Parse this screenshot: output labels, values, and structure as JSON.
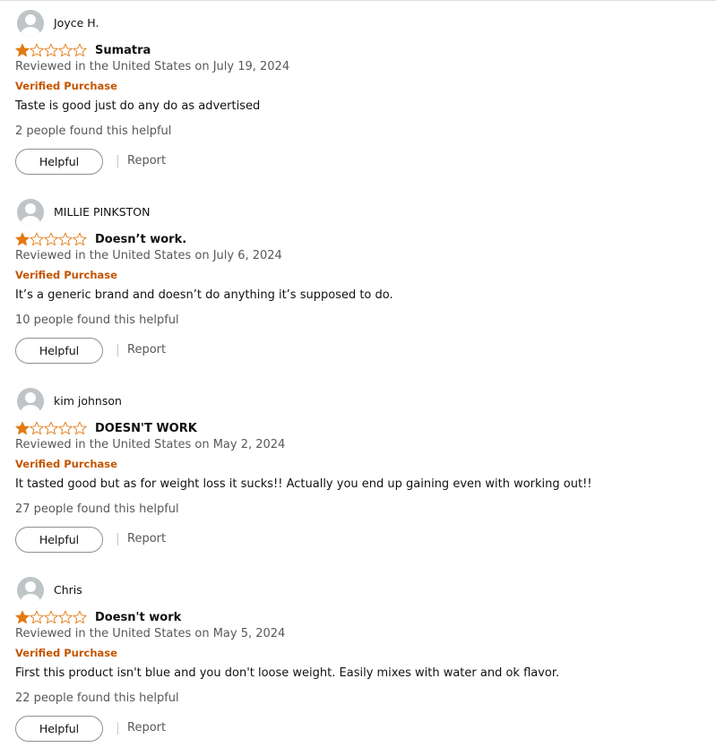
{
  "colors": {
    "star_fill": "#e47911",
    "star_outline": "#e47911",
    "verified": "#c45500",
    "muted_text": "#565959"
  },
  "reviews": [
    {
      "author": "Joyce H.",
      "rating": 1,
      "max_rating": 5,
      "title": "Sumatra",
      "date": "Reviewed in the United States on July 19, 2024",
      "verified": "Verified Purchase",
      "body": "Taste is good just do any do as advertised",
      "helpful_count": "2 people found this helpful",
      "helpful_label": "Helpful",
      "report_label": "Report"
    },
    {
      "author": "MILLIE PINKSTON",
      "rating": 1,
      "max_rating": 5,
      "title": "Doesn’t work.",
      "date": "Reviewed in the United States on July 6, 2024",
      "verified": "Verified Purchase",
      "body": "It’s a generic brand and doesn’t do anything it’s supposed to do.",
      "helpful_count": "10 people found this helpful",
      "helpful_label": "Helpful",
      "report_label": "Report"
    },
    {
      "author": "kim johnson",
      "rating": 1,
      "max_rating": 5,
      "title": "DOESN'T WORK",
      "date": "Reviewed in the United States on May 2, 2024",
      "verified": "Verified Purchase",
      "body": "It tasted good but as for weight loss it sucks!! Actually you end up gaining even with working out!!",
      "helpful_count": "27 people found this helpful",
      "helpful_label": "Helpful",
      "report_label": "Report"
    },
    {
      "author": "Chris",
      "rating": 1,
      "max_rating": 5,
      "title": "Doesn't work",
      "date": "Reviewed in the United States on May 5, 2024",
      "verified": "Verified Purchase",
      "body": "First this product isn't blue and you don't loose weight. Easily mixes with water and ok flavor.",
      "helpful_count": "22 people found this helpful",
      "helpful_label": "Helpful",
      "report_label": "Report"
    }
  ]
}
